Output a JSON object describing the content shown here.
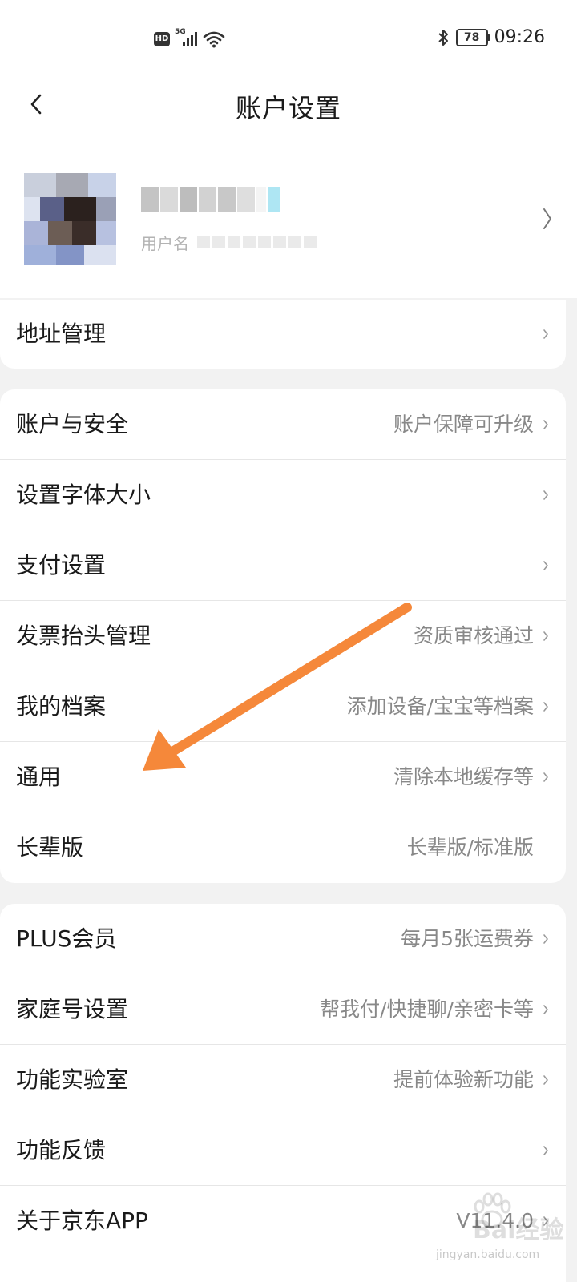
{
  "status_bar": {
    "hd": "HD",
    "network": "5G",
    "battery": "78",
    "time": "09:26"
  },
  "nav": {
    "title": "账户设置"
  },
  "profile": {
    "username_label": "用户名"
  },
  "groups": [
    {
      "items": [
        {
          "label": "地址管理",
          "value": ""
        }
      ]
    },
    {
      "items": [
        {
          "label": "账户与安全",
          "value": "账户保障可升级"
        },
        {
          "label": "设置字体大小",
          "value": ""
        },
        {
          "label": "支付设置",
          "value": ""
        },
        {
          "label": "发票抬头管理",
          "value": "资质审核通过"
        },
        {
          "label": "我的档案",
          "value": "添加设备/宝宝等档案"
        },
        {
          "label": "通用",
          "value": "清除本地缓存等"
        },
        {
          "label": "长辈版",
          "value": "长辈版/标准版"
        }
      ]
    },
    {
      "items": [
        {
          "label": "PLUS会员",
          "value": "每月5张运费券"
        },
        {
          "label": "家庭号设置",
          "value": "帮我付/快捷聊/亲密卡等"
        },
        {
          "label": "功能实验室",
          "value": "提前体验新功能"
        },
        {
          "label": "功能反馈",
          "value": ""
        },
        {
          "label": "关于京东APP",
          "value": "V11.4.0"
        }
      ]
    }
  ],
  "annotation": {
    "arrow_color": "#f5883a"
  },
  "watermark": {
    "text": "Bai经验",
    "url": "jingyan.baidu.com"
  },
  "colors": {
    "background": "#f2f2f2",
    "card": "#ffffff",
    "label": "#1a1a1a",
    "value": "#888888",
    "divider": "#e6e6e6"
  }
}
